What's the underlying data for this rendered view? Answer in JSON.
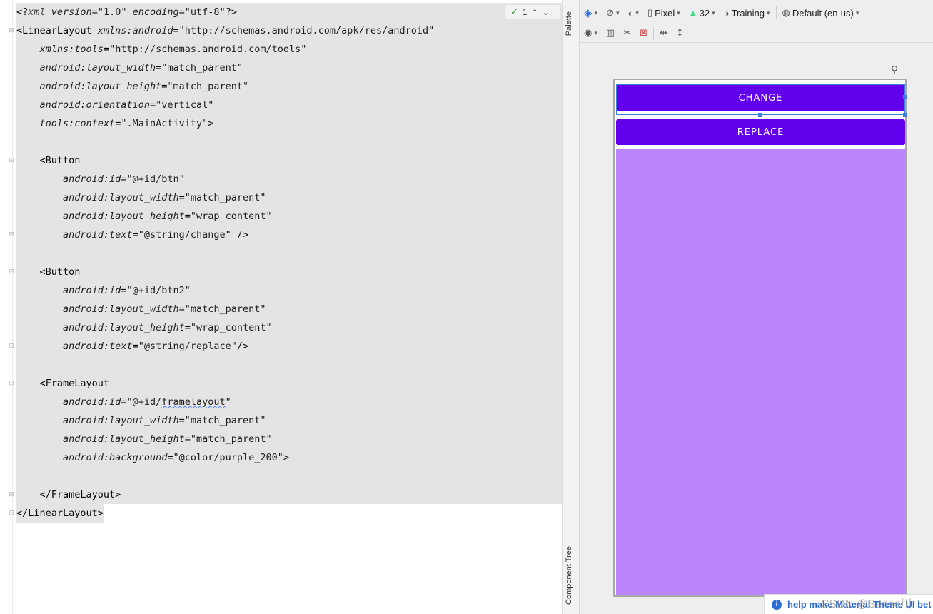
{
  "editor": {
    "inspection": {
      "count": "1"
    },
    "lines": [
      {
        "parts": [
          [
            "t",
            "<?"
          ],
          [
            "ns",
            "xml"
          ],
          [
            "t",
            " "
          ],
          [
            "attr",
            "version"
          ],
          [
            "t",
            "="
          ],
          [
            "val",
            "\"1.0\""
          ],
          [
            "t",
            " "
          ],
          [
            "attr",
            "encoding"
          ],
          [
            "t",
            "="
          ],
          [
            "val",
            "\"utf-8\""
          ],
          [
            "t",
            "?>"
          ]
        ]
      },
      {
        "parts": [
          [
            "t",
            "<LinearLayout "
          ],
          [
            "attr",
            "xmlns:android"
          ],
          [
            "t",
            "="
          ],
          [
            "val",
            "\"http://schemas.android.com/apk/res/android\""
          ]
        ]
      },
      {
        "parts": [
          [
            "t",
            "    "
          ],
          [
            "attr",
            "xmlns:tools"
          ],
          [
            "t",
            "="
          ],
          [
            "val",
            "\"http://schemas.android.com/tools\""
          ]
        ]
      },
      {
        "parts": [
          [
            "t",
            "    "
          ],
          [
            "attr",
            "android:layout_width"
          ],
          [
            "t",
            "="
          ],
          [
            "val",
            "\"match_parent\""
          ]
        ]
      },
      {
        "parts": [
          [
            "t",
            "    "
          ],
          [
            "attr",
            "android:layout_height"
          ],
          [
            "t",
            "="
          ],
          [
            "val",
            "\"match_parent\""
          ]
        ]
      },
      {
        "parts": [
          [
            "t",
            "    "
          ],
          [
            "attr",
            "android:orientation"
          ],
          [
            "t",
            "="
          ],
          [
            "val",
            "\"vertical\""
          ]
        ]
      },
      {
        "parts": [
          [
            "t",
            "    "
          ],
          [
            "attr",
            "tools:context"
          ],
          [
            "t",
            "="
          ],
          [
            "val",
            "\".MainActivity\""
          ],
          [
            "t",
            ">"
          ]
        ]
      },
      {
        "parts": []
      },
      {
        "parts": [
          [
            "t",
            "    <Button"
          ]
        ]
      },
      {
        "parts": [
          [
            "t",
            "        "
          ],
          [
            "attr",
            "android:id"
          ],
          [
            "t",
            "="
          ],
          [
            "val",
            "\"@+id/btn\""
          ]
        ]
      },
      {
        "parts": [
          [
            "t",
            "        "
          ],
          [
            "attr",
            "android:layout_width"
          ],
          [
            "t",
            "="
          ],
          [
            "val",
            "\"match_parent\""
          ]
        ]
      },
      {
        "parts": [
          [
            "t",
            "        "
          ],
          [
            "attr",
            "android:layout_height"
          ],
          [
            "t",
            "="
          ],
          [
            "val",
            "\"wrap_content\""
          ]
        ]
      },
      {
        "parts": [
          [
            "t",
            "        "
          ],
          [
            "attr",
            "android:text"
          ],
          [
            "t",
            "="
          ],
          [
            "val",
            "\"@string/change\""
          ],
          [
            "t",
            " />"
          ]
        ]
      },
      {
        "parts": []
      },
      {
        "parts": [
          [
            "t",
            "    <Button"
          ]
        ]
      },
      {
        "parts": [
          [
            "t",
            "        "
          ],
          [
            "attr",
            "android:id"
          ],
          [
            "t",
            "="
          ],
          [
            "val",
            "\"@+id/btn2\""
          ]
        ]
      },
      {
        "parts": [
          [
            "t",
            "        "
          ],
          [
            "attr",
            "android:layout_width"
          ],
          [
            "t",
            "="
          ],
          [
            "val",
            "\"match_parent\""
          ]
        ]
      },
      {
        "parts": [
          [
            "t",
            "        "
          ],
          [
            "attr",
            "android:layout_height"
          ],
          [
            "t",
            "="
          ],
          [
            "val",
            "\"wrap_content\""
          ]
        ]
      },
      {
        "parts": [
          [
            "t",
            "        "
          ],
          [
            "attr",
            "android:text"
          ],
          [
            "t",
            "="
          ],
          [
            "val",
            "\"@string/replace\""
          ],
          [
            "t",
            "/>"
          ]
        ]
      },
      {
        "parts": []
      },
      {
        "parts": [
          [
            "t",
            "    <FrameLayout"
          ]
        ]
      },
      {
        "parts": [
          [
            "t",
            "        "
          ],
          [
            "attr",
            "android:id"
          ],
          [
            "t",
            "="
          ],
          [
            "val",
            "\"@+id/"
          ],
          [
            "typo",
            "framelayout"
          ],
          [
            "val",
            "\""
          ]
        ]
      },
      {
        "parts": [
          [
            "t",
            "        "
          ],
          [
            "attr",
            "android:layout_width"
          ],
          [
            "t",
            "="
          ],
          [
            "val",
            "\"match_parent\""
          ]
        ]
      },
      {
        "parts": [
          [
            "t",
            "        "
          ],
          [
            "attr",
            "android:layout_height"
          ],
          [
            "t",
            "="
          ],
          [
            "val",
            "\"match_parent\""
          ]
        ]
      },
      {
        "parts": [
          [
            "t",
            "        "
          ],
          [
            "attr",
            "android:background"
          ],
          [
            "t",
            "="
          ],
          [
            "val",
            "\"@color/purple_200\""
          ],
          [
            "t",
            ">"
          ]
        ]
      },
      {
        "parts": []
      },
      {
        "parts": [
          [
            "t",
            "    </FrameLayout>"
          ]
        ]
      },
      {
        "parts": [
          [
            "t",
            "</LinearLayout>"
          ]
        ]
      }
    ]
  },
  "side_tabs": {
    "palette": "Palette",
    "component_tree": "Component Tree"
  },
  "design_toolbar": {
    "device": "Pixel",
    "api_level": "32",
    "theme": "Training",
    "locale": "Default (en-us)"
  },
  "preview": {
    "button_change": "CHANGE",
    "button_replace": "REPLACE",
    "colors": {
      "primary": "#6200ee",
      "frame_background": "#bb86fc",
      "selection": "#3b7de0"
    }
  },
  "notification": {
    "text": "help make Material Theme UI bet"
  },
  "watermark": "CSDN @Sense川"
}
